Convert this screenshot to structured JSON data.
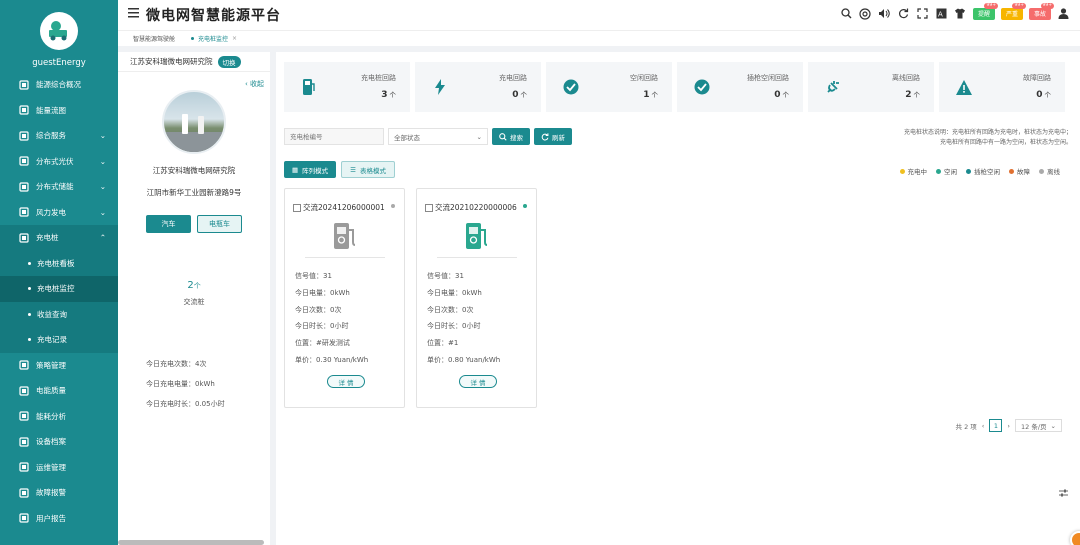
{
  "app": {
    "title": "微电网智慧能源平台",
    "username": "guestEnergy"
  },
  "colors": {
    "primary": "#1b8a8f",
    "charging": "#f0c020",
    "idle": "#2aa78f",
    "gun_idle": "#1b8a8f",
    "fault": "#e07030",
    "offline": "#aaaaaa"
  },
  "header_buttons": [
    {
      "label": "提醒",
      "badge": "99+",
      "color": "#3cc46a"
    },
    {
      "label": "严重",
      "badge": "99+",
      "color": "#f7b500"
    },
    {
      "label": "事故",
      "badge": "99+",
      "color": "#f56c6c"
    }
  ],
  "header_icons": [
    "search-icon",
    "help-icon",
    "volume-icon",
    "refresh-icon",
    "fullscreen-icon",
    "font-size-icon",
    "theme-shirt-icon",
    "user-icon"
  ],
  "tabs": [
    {
      "label": "智慧能源驾驶舱"
    },
    {
      "label": "充电桩监控",
      "active": true
    }
  ],
  "sidebar": {
    "items": [
      {
        "label": "能源综合概况",
        "icon": "overview-icon"
      },
      {
        "label": "能量流图",
        "icon": "flow-icon"
      },
      {
        "label": "综合服务",
        "icon": "service-icon",
        "has_children": true
      },
      {
        "label": "分布式光伏",
        "icon": "pv-icon",
        "has_children": true
      },
      {
        "label": "分布式储能",
        "icon": "storage-icon",
        "has_children": true
      },
      {
        "label": "风力发电",
        "icon": "wind-icon",
        "has_children": true
      },
      {
        "label": "充电桩",
        "icon": "charger-icon",
        "has_children": true,
        "open": true
      }
    ],
    "subitems": [
      {
        "label": "充电桩看板"
      },
      {
        "label": "充电桩监控",
        "active": true
      },
      {
        "label": "收益查询"
      },
      {
        "label": "充电记录"
      }
    ],
    "items_after": [
      {
        "label": "策略管理",
        "icon": "strategy-icon"
      },
      {
        "label": "电能质量",
        "icon": "quality-icon"
      },
      {
        "label": "能耗分析",
        "icon": "analysis-icon"
      },
      {
        "label": "设备档案",
        "icon": "device-icon"
      },
      {
        "label": "运维管理",
        "icon": "ops-icon"
      },
      {
        "label": "故障报警",
        "icon": "alarm-icon"
      },
      {
        "label": "用户报告",
        "icon": "report-icon"
      }
    ]
  },
  "station": {
    "header": "江苏安科瑞微电网研究院",
    "switch_label": "切换",
    "collapse_label": "收起",
    "name": "江苏安科瑞微电网研究院",
    "address": "江阴市新华工业园新澄路9号",
    "type_car": "汽车",
    "type_ebike": "电瓶车",
    "pile_count": "2",
    "pile_count_unit": "个",
    "pile_type_label": "交流桩",
    "today_times": "今日充电次数：4次",
    "today_energy": "今日充电电量：0kWh",
    "today_duration": "今日充电时长：0.05小时"
  },
  "stats": [
    {
      "label": "充电桩回路",
      "value": "3",
      "unit": "个",
      "icon": "charging-pile-icon",
      "color": "#1b8a8f"
    },
    {
      "label": "充电回路",
      "value": "0",
      "unit": "个",
      "icon": "lightning-icon",
      "color": "#1b8a8f"
    },
    {
      "label": "空闲回路",
      "value": "1",
      "unit": "个",
      "icon": "check-circle-icon",
      "color": "#1b8a8f"
    },
    {
      "label": "插枪空闲回路",
      "value": "0",
      "unit": "个",
      "icon": "check-circle-icon",
      "color": "#1b8a8f"
    },
    {
      "label": "离线回路",
      "value": "2",
      "unit": "个",
      "icon": "plug-offline-icon",
      "color": "#1b8a8f"
    },
    {
      "label": "故障回路",
      "value": "0",
      "unit": "个",
      "icon": "warning-icon",
      "color": "#1b8a8f"
    }
  ],
  "filters": {
    "pile_no_placeholder": "充电枪编号",
    "status_value": "全部状态",
    "search_label": "搜索",
    "refresh_label": "刷新"
  },
  "status_note": {
    "line1": "充电桩状态说明：充电桩所有回路为充电时，桩状态为充电中；",
    "line2": "充电桩所有回路中有一路为空闲，桩状态为空闲。"
  },
  "modes": {
    "list": "阵列模式",
    "table": "表格模式"
  },
  "legend": [
    {
      "label": "充电中",
      "color": "#f0c020"
    },
    {
      "label": "空闲",
      "color": "#2aa78f"
    },
    {
      "label": "插枪空闲",
      "color": "#1b8a8f"
    },
    {
      "label": "故障",
      "color": "#e07030"
    },
    {
      "label": "离线",
      "color": "#aaaaaa"
    }
  ],
  "piles": [
    {
      "id": "交流20241206000001",
      "status_color": "#aaaaaa",
      "icon_color": "#9a9a9a",
      "signal": "信号值：31",
      "energy": "今日电量：0kWh",
      "times": "今日次数：0次",
      "duration": "今日时长：0小时",
      "location": "位置：#研发测试",
      "price": "单价：0.30 Yuan/kWh",
      "detail_label": "详 情"
    },
    {
      "id": "交流20210220000006",
      "status_color": "#2aa78f",
      "icon_color": "#2aa78f",
      "signal": "信号值：31",
      "energy": "今日电量：0kWh",
      "times": "今日次数：0次",
      "duration": "今日时长：0小时",
      "location": "位置：#1",
      "price": "单价：0.80 Yuan/kWh",
      "detail_label": "详 情"
    }
  ],
  "pager": {
    "total": "共 2 项",
    "page": "1",
    "size": "12 条/页"
  }
}
